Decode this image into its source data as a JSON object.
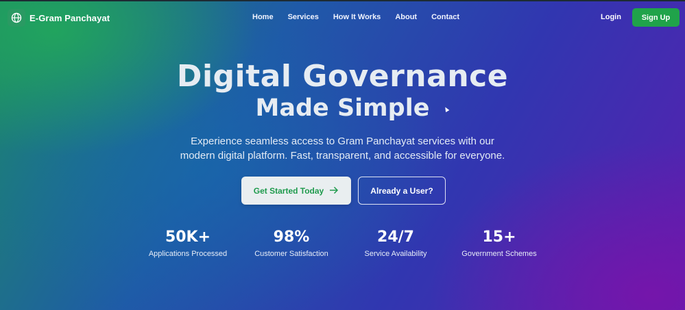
{
  "brand": {
    "name": "E-Gram Panchayat",
    "icon": "globe-icon",
    "accent": "#2a9a63"
  },
  "nav": {
    "links": [
      "Home",
      "Services",
      "How It Works",
      "About",
      "Contact"
    ],
    "login": "Login",
    "signup": "Sign Up",
    "signup_color": "#20a34a"
  },
  "hero": {
    "title_line1": "Digital Governance",
    "title_line2": "Made Simple",
    "subtitle_line1": "Experience seamless access to Gram Panchayat services with our",
    "subtitle_line2": "modern digital platform. Fast, transparent, and accessible for everyone.",
    "primary_button": "Get Started Today",
    "primary_button_icon": "arrow-right-icon",
    "secondary_button": "Already a User?"
  },
  "stats": [
    {
      "value": "50K+",
      "label": "Applications Processed"
    },
    {
      "value": "98%",
      "label": "Customer Satisfaction"
    },
    {
      "value": "24/7",
      "label": "Service Availability"
    },
    {
      "value": "15+",
      "label": "Government Schemes"
    }
  ]
}
